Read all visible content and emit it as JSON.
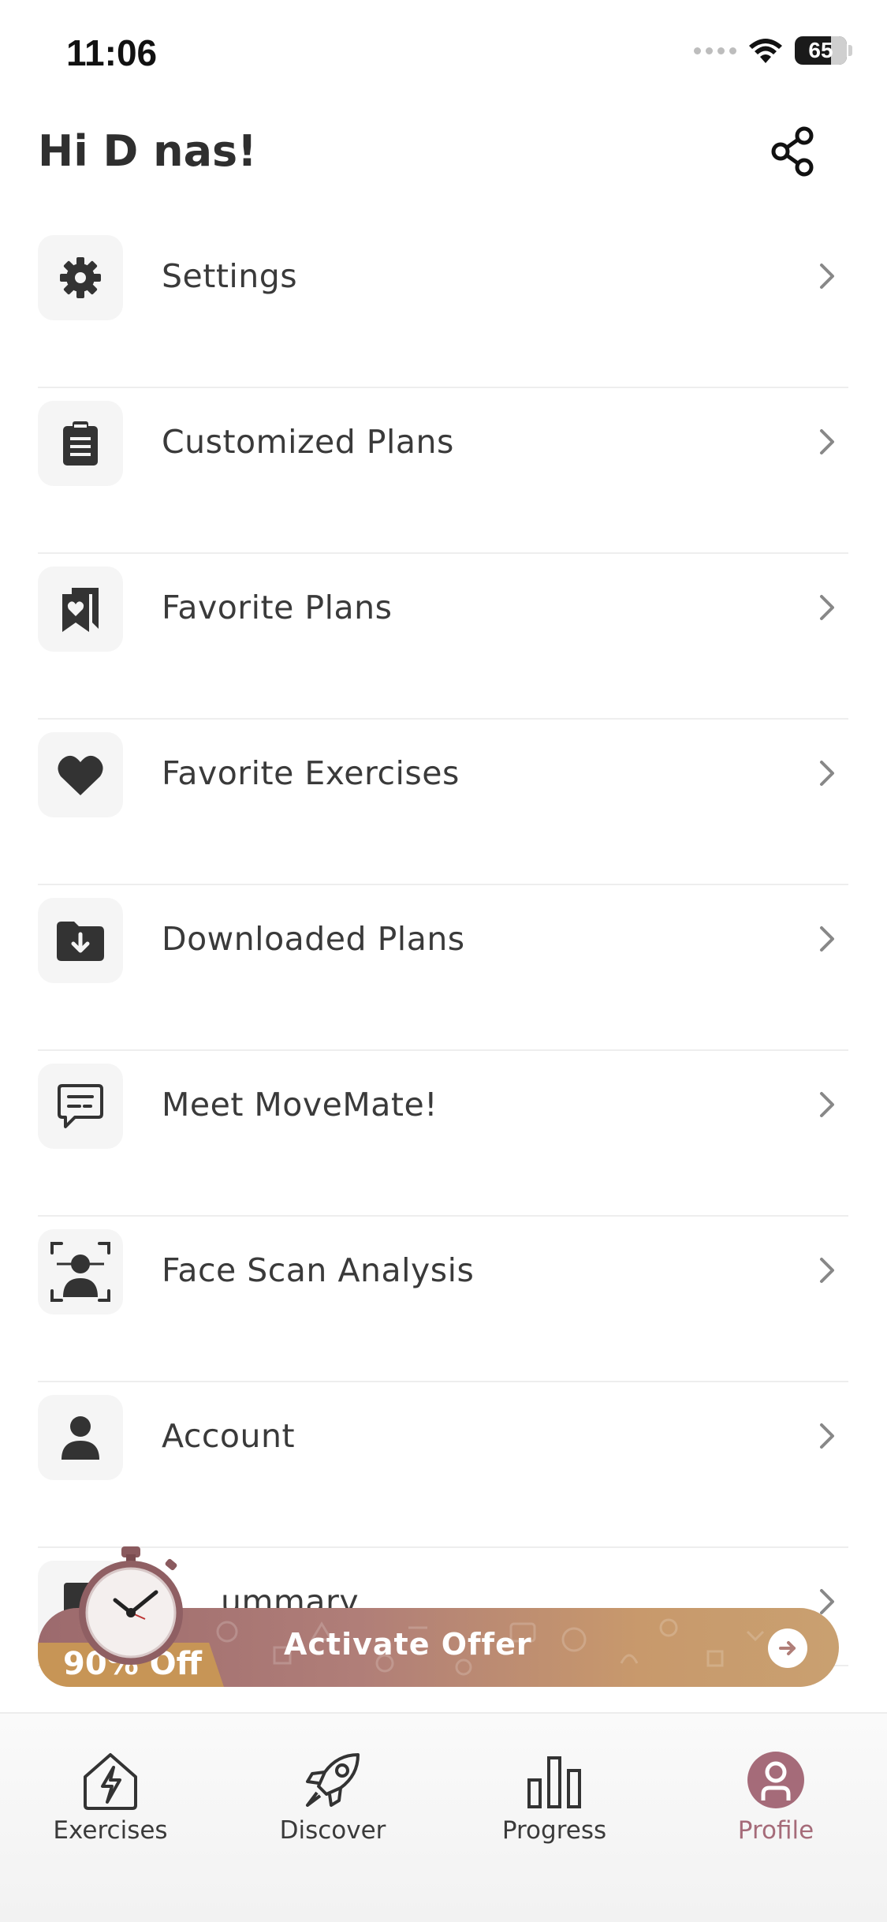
{
  "status_bar": {
    "time": "11:06",
    "battery": "65"
  },
  "header": {
    "greeting": "Hi D nas!"
  },
  "menu": {
    "items": [
      {
        "label": "Settings",
        "icon": "gear-icon"
      },
      {
        "label": "Customized Plans",
        "icon": "clipboard-icon"
      },
      {
        "label": "Favorite Plans",
        "icon": "bookmark-heart-icon"
      },
      {
        "label": "Favorite Exercises",
        "icon": "heart-icon"
      },
      {
        "label": "Downloaded Plans",
        "icon": "folder-download-icon"
      },
      {
        "label": "Meet MoveMate!",
        "icon": "chat-bubble-icon"
      },
      {
        "label": "Face Scan Analysis",
        "icon": "face-scan-icon"
      },
      {
        "label": "Account",
        "icon": "user-icon"
      },
      {
        "label": "Summary",
        "visible_label": "ummary",
        "icon": "document-icon"
      }
    ]
  },
  "offer": {
    "label": "Activate Offer",
    "discount": "90% Off"
  },
  "tab_bar": {
    "tabs": [
      {
        "label": "Exercises",
        "icon": "house-lightning-icon"
      },
      {
        "label": "Discover",
        "icon": "rocket-icon"
      },
      {
        "label": "Progress",
        "icon": "bar-chart-icon"
      },
      {
        "label": "Profile",
        "icon": "profile-icon",
        "active": true
      }
    ]
  },
  "colors": {
    "accent": "#a56b79",
    "offer_start": "#9c6a6d",
    "offer_end": "#c9a070",
    "discount": "#c79556"
  }
}
